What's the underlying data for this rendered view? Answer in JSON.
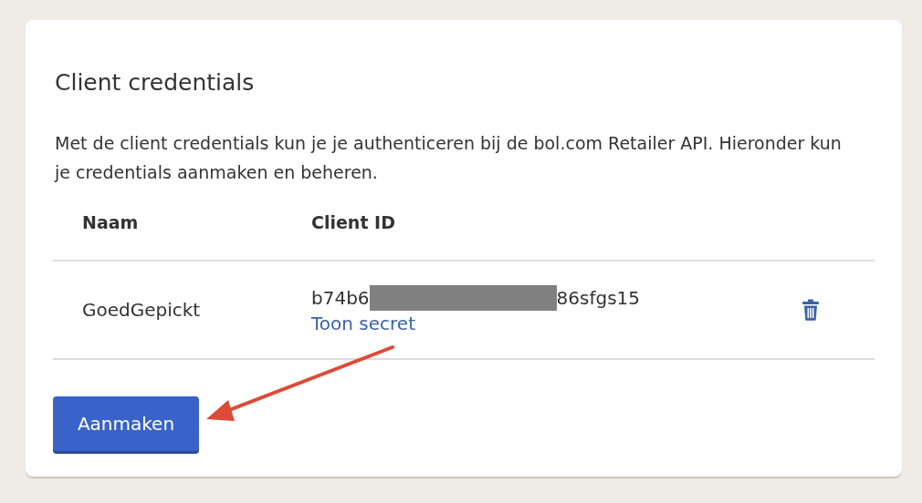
{
  "card": {
    "title": "Client credentials",
    "description": "Met de client credentials kun je je authenticeren bij de bol.com Retailer API. Hieronder kun je credentials aanmaken en beheren."
  },
  "table": {
    "columns": [
      "Naam",
      "Client ID"
    ],
    "rows": [
      {
        "name": "GoedGepickt",
        "client_id_start": "b74b6",
        "client_id_end": "86sfgs15",
        "link": "Toon secret"
      }
    ]
  },
  "button": "Aanmaken"
}
